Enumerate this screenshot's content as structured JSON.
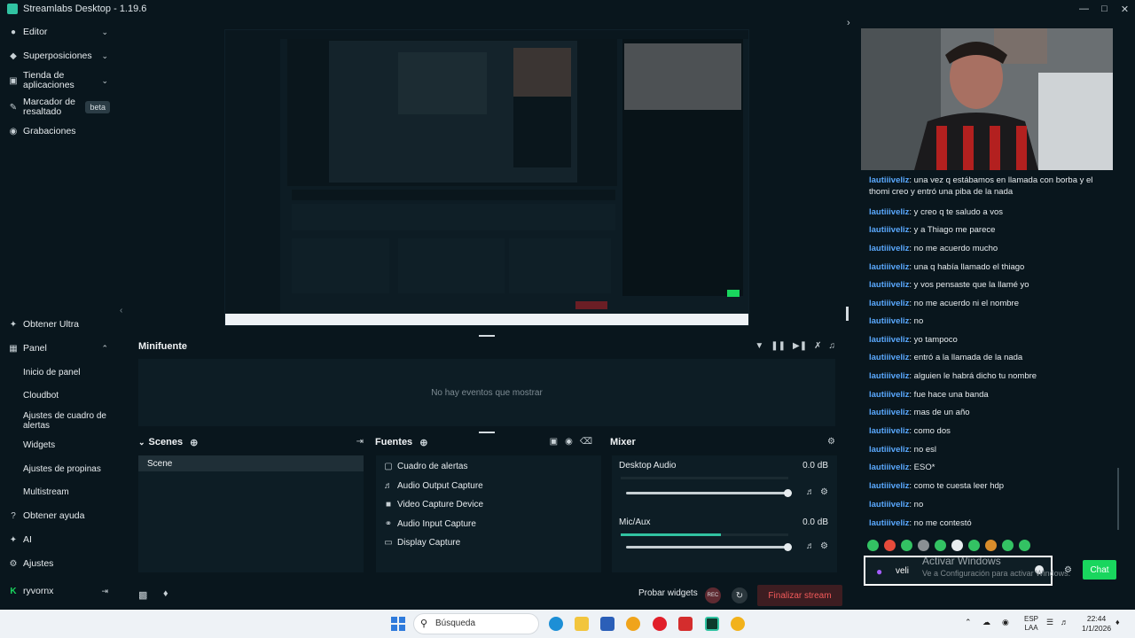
{
  "window": {
    "title": "Streamlabs Desktop - 1.19.6"
  },
  "sidebar": {
    "top_items": [
      {
        "label": "Editor"
      },
      {
        "label": "Superposiciones"
      },
      {
        "label": "Tienda de aplicaciones"
      },
      {
        "label": "Marcador de resaltado",
        "badge": "beta"
      },
      {
        "label": "Grabaciones"
      }
    ],
    "bottom_items": {
      "ultra": "Obtener Ultra",
      "panel": "Panel",
      "panel_sub": [
        "Inicio de panel",
        "Cloudbot",
        "Ajustes de cuadro de alertas",
        "Widgets",
        "Ajustes de propinas",
        "Multistream"
      ],
      "help": "Obtener ayuda",
      "ai": "AI",
      "settings": "Ajustes",
      "user": "ryvornx"
    }
  },
  "minifuente": {
    "title": "Minifuente",
    "empty": "No hay eventos que mostrar"
  },
  "scenes": {
    "title": "Scenes",
    "items": [
      "Scene"
    ]
  },
  "sources": {
    "title": "Fuentes",
    "items": [
      {
        "label": "Cuadro de alertas",
        "icon": "alert-box-icon"
      },
      {
        "label": "Audio Output Capture",
        "icon": "speaker-icon"
      },
      {
        "label": "Video Capture Device",
        "icon": "camera-icon"
      },
      {
        "label": "Audio Input Capture",
        "icon": "microphone-icon"
      },
      {
        "label": "Display Capture",
        "icon": "monitor-icon"
      }
    ]
  },
  "mixer": {
    "title": "Mixer",
    "channels": [
      {
        "name": "Desktop Audio",
        "db": "0.0 dB",
        "volume": 1.0,
        "level": 0.0
      },
      {
        "name": "Mic/Aux",
        "db": "0.0 dB",
        "volume": 1.0,
        "level": 0.6
      }
    ]
  },
  "footer": {
    "test_widgets": "Probar widgets",
    "rec": "REC",
    "end_stream": "Finalizar stream"
  },
  "chat": {
    "messages": [
      {
        "user": "lautiiiveliz",
        "text": ": una vez q estábamos en llamada con borba y el thomi creo y entró una piba de la nada"
      },
      {
        "user": "lautiiiveliz",
        "text": ": y creo q te saludo a vos"
      },
      {
        "user": "lautiiiveliz",
        "text": ": y a Thiago me parece"
      },
      {
        "user": "lautiiiveliz",
        "text": ": no me acuerdo mucho"
      },
      {
        "user": "lautiiiveliz",
        "text": ": una q había llamado el thiago"
      },
      {
        "user": "lautiiiveliz",
        "text": ": y vos pensaste que la llamé yo"
      },
      {
        "user": "lautiiiveliz",
        "text": ": no me acuerdo ni el nombre"
      },
      {
        "user": "lautiiiveliz",
        "text": ": no"
      },
      {
        "user": "lautiiiveliz",
        "text": ": yo tampoco"
      },
      {
        "user": "lautiiiveliz",
        "text": ": entró a la llamada de la nada"
      },
      {
        "user": "lautiiiveliz",
        "text": ": alguien le habrá dicho tu nombre"
      },
      {
        "user": "lautiiiveliz",
        "text": ": fue hace una banda"
      },
      {
        "user": "lautiiiveliz",
        "text": ": mas de un año"
      },
      {
        "user": "lautiiiveliz",
        "text": ": como dos"
      },
      {
        "user": "lautiiiveliz",
        "text": ": no esl"
      },
      {
        "user": "lautiiiveliz",
        "text": ": ESO*"
      },
      {
        "user": "lautiiiveliz",
        "text": ": como te cuesta leer hdp"
      },
      {
        "user": "lautiiiveliz",
        "text": ": no"
      },
      {
        "user": "lautiiiveliz",
        "text": ": no me contestó"
      }
    ],
    "input_value": "veli",
    "send": "Chat",
    "watermark_title": "Activar Windows",
    "watermark_sub": "Ve a Configuración para activar Windows."
  },
  "taskbar": {
    "search": "Búsqueda",
    "lang": "ESP",
    "lang2": "LAA",
    "time": "22:44",
    "date": "1/1/2026"
  },
  "colors": {
    "accent": "#31c3a2",
    "chat_user": "#5aa9ff",
    "chat_button": "#19d65e",
    "end_stream": "#f45a5a"
  }
}
